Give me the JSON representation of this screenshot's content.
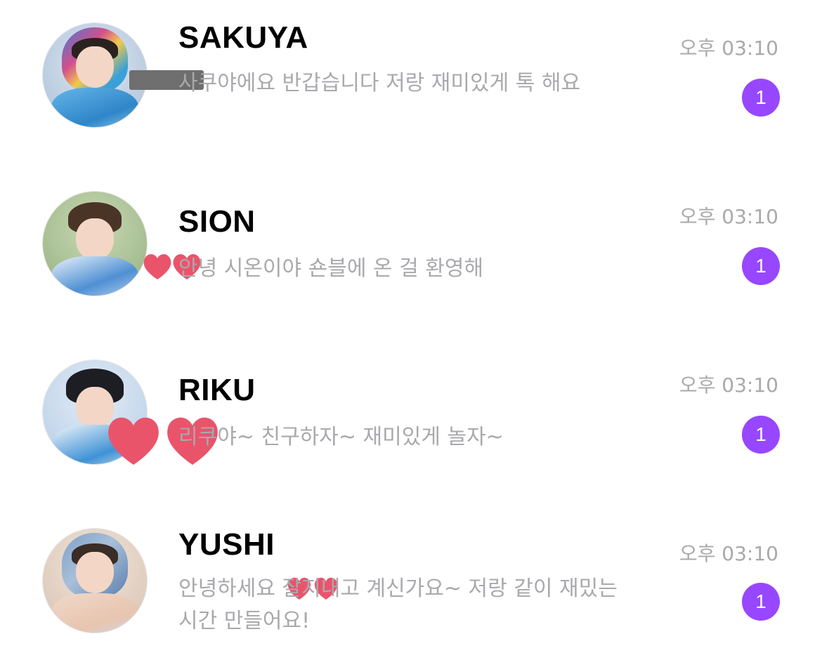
{
  "accent_color": "#9747ff",
  "chats": [
    {
      "name": "SAKUYA",
      "preview": "  사쿠야에요 반갑습니다 저랑 재미있게 톡 해요",
      "time": "오후 03:10",
      "unread": "1",
      "avatar_icon": "profile-photo"
    },
    {
      "name": "SION",
      "preview": "   안녕 시온이야 숀블에 온 걸 환영해 ",
      "time": "오후 03:10",
      "unread": "1",
      "avatar_icon": "profile-photo"
    },
    {
      "name": "RIKU",
      "preview": "      리쿠야~ 친구하자~ 재미있게 놀자~",
      "time": "오후 03:10",
      "unread": "1",
      "avatar_icon": "profile-photo"
    },
    {
      "name": "YUSHI",
      "preview": "안녕하세요      잘지내고 계신가요~ 저랑 같이 재밌는 시간 만들어요!",
      "time": "오후 03:10",
      "unread": "1",
      "avatar_icon": "profile-photo"
    }
  ]
}
